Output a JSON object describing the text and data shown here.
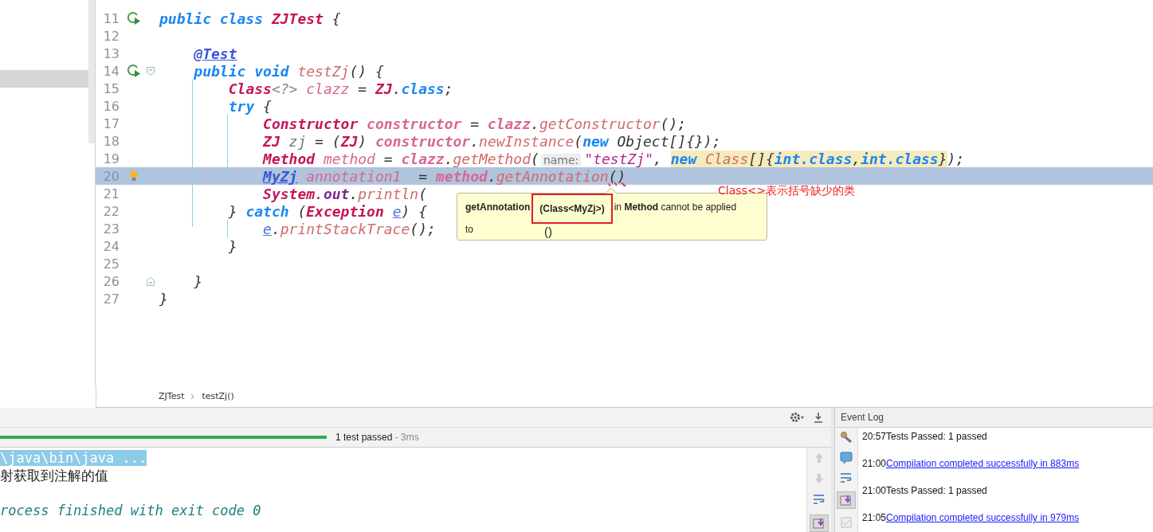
{
  "editor": {
    "lines": [
      {
        "number": "11",
        "selected": false,
        "gutter": {
          "kind": "run"
        },
        "tokens": [
          {
            "kind": "kw",
            "t": "public class "
          },
          {
            "kind": "type",
            "t": "ZJTest"
          },
          {
            "kind": "plain",
            "t": " {"
          }
        ]
      },
      {
        "number": "12",
        "selected": false
      },
      {
        "number": "13",
        "selected": false,
        "tokens": [
          {
            "kind": "annot",
            "t": "    @Test"
          }
        ]
      },
      {
        "number": "14",
        "selected": false,
        "gutter": {
          "kind": "run"
        },
        "fold": {
          "kind": "start"
        },
        "tokens": [
          {
            "kind": "kw",
            "t": "    public void "
          },
          {
            "kind": "method",
            "t": "testZj"
          },
          {
            "kind": "plain",
            "t": "() {"
          }
        ]
      },
      {
        "number": "15",
        "selected": false,
        "tokens": [
          {
            "kind": "type",
            "t": "        Class"
          },
          {
            "kind": "gen",
            "t": "<?>"
          },
          {
            "kind": "local",
            "t": " clazz"
          },
          {
            "kind": "plain",
            "t": " = "
          },
          {
            "kind": "type",
            "t": "ZJ"
          },
          {
            "kind": "plain",
            "t": "."
          },
          {
            "kind": "kw",
            "t": "class"
          },
          {
            "kind": "plain",
            "t": ";"
          }
        ]
      },
      {
        "number": "16",
        "selected": false,
        "tokens": [
          {
            "kind": "kw",
            "t": "        try"
          },
          {
            "kind": "plain",
            "t": " {"
          }
        ]
      },
      {
        "number": "17",
        "selected": false,
        "tokens": [
          {
            "kind": "type",
            "t": "            Constructor"
          },
          {
            "kind": "var",
            "t": " constructor"
          },
          {
            "kind": "plain",
            "t": " = "
          },
          {
            "kind": "var",
            "t": "clazz"
          },
          {
            "kind": "plain",
            "t": "."
          },
          {
            "kind": "method",
            "t": "getConstructor"
          },
          {
            "kind": "plain",
            "t": "();"
          }
        ]
      },
      {
        "number": "18",
        "selected": false,
        "tokens": [
          {
            "kind": "type",
            "t": "            ZJ"
          },
          {
            "kind": "unused",
            "t": " zj"
          },
          {
            "kind": "plain",
            "t": " = ("
          },
          {
            "kind": "type",
            "t": "ZJ"
          },
          {
            "kind": "plain",
            "t": ") "
          },
          {
            "kind": "var",
            "t": "constructor"
          },
          {
            "kind": "plain",
            "t": "."
          },
          {
            "kind": "method",
            "t": "newInstance"
          },
          {
            "kind": "plain",
            "t": "("
          },
          {
            "kind": "kw",
            "t": "new"
          },
          {
            "kind": "plain",
            "t": " Object[]{});"
          }
        ]
      },
      {
        "number": "19",
        "selected": false,
        "tokens": [
          {
            "kind": "type",
            "t": "            Method"
          },
          {
            "kind": "local",
            "t": " method"
          },
          {
            "kind": "plain",
            "t": " = "
          },
          {
            "kind": "var",
            "t": "clazz"
          },
          {
            "kind": "plain",
            "t": "."
          },
          {
            "kind": "method",
            "t": "getMethod"
          },
          {
            "kind": "plain",
            "t": "("
          },
          {
            "kind": "hint",
            "t": "name:"
          },
          {
            "kind": "string",
            "t": "\"testZj\""
          },
          {
            "kind": "plain",
            "t": ", "
          },
          {
            "kind": "group",
            "parts": [
              {
                "kind": "kw",
                "t": "new"
              },
              {
                "kind": "method",
                "t": " Class"
              },
              {
                "kind": "plain",
                "t": "[]{"
              },
              {
                "kind": "kw",
                "t": "int.class"
              },
              {
                "kind": "plain",
                "t": ","
              },
              {
                "kind": "kw",
                "t": "int.class"
              },
              {
                "kind": "plain",
                "t": "}"
              }
            ]
          },
          {
            "kind": "plain",
            "t": ");"
          }
        ]
      },
      {
        "number": "20",
        "selected": true,
        "gutter": {
          "kind": "bulb"
        },
        "tokens": [
          {
            "kind": "annot",
            "t": "            MyZj"
          },
          {
            "kind": "local",
            "t": " annotation1"
          },
          {
            "kind": "plain",
            "t": "  = "
          },
          {
            "kind": "var",
            "t": "method"
          },
          {
            "kind": "plain",
            "t": "."
          },
          {
            "kind": "method",
            "t": "getAnnotation"
          },
          {
            "kind": "error",
            "t": "()"
          }
        ]
      },
      {
        "number": "21",
        "selected": false,
        "tokens": [
          {
            "kind": "type",
            "t": "            System"
          },
          {
            "kind": "plain",
            "t": "."
          },
          {
            "kind": "field",
            "t": "out"
          },
          {
            "kind": "plain",
            "t": "."
          },
          {
            "kind": "method",
            "t": "println"
          },
          {
            "kind": "plain",
            "t": "("
          }
        ]
      },
      {
        "number": "22",
        "selected": false,
        "tokens": [
          {
            "kind": "plain",
            "t": "        } "
          },
          {
            "kind": "kw",
            "t": "catch"
          },
          {
            "kind": "plain",
            "t": " ("
          },
          {
            "kind": "type",
            "t": "Exception"
          },
          {
            "kind": "param",
            "t": " e"
          },
          {
            "kind": "plain",
            "t": ") {"
          }
        ]
      },
      {
        "number": "23",
        "selected": false,
        "tokens": [
          {
            "kind": "param",
            "t": "            e"
          },
          {
            "kind": "plain",
            "t": "."
          },
          {
            "kind": "method",
            "t": "printStackTrace"
          },
          {
            "kind": "plain",
            "t": "();"
          }
        ]
      },
      {
        "number": "24",
        "selected": false,
        "tokens": [
          {
            "kind": "plain",
            "t": "        }"
          }
        ]
      },
      {
        "number": "25",
        "selected": false
      },
      {
        "number": "26",
        "selected": false,
        "fold": {
          "kind": "end"
        },
        "tokens": [
          {
            "kind": "plain",
            "t": "    }"
          }
        ]
      },
      {
        "number": "27",
        "selected": false,
        "tokens": [
          {
            "kind": "plain",
            "t": "}"
          }
        ]
      }
    ],
    "tooltip": {
      "method": "getAnnotation",
      "signature": "(Class<MyZj>)",
      "message": "in **Method** cannot be applied",
      "line2_label": "to",
      "line2_value": "()"
    },
    "annotation_note": "Class<>表示括号缺少的类",
    "breadcrumbs": [
      "ZJTest",
      "testZj()"
    ]
  },
  "run_panel": {
    "progress": {
      "level": 1,
      "text": "1 test passed",
      "time": " - 3ms"
    },
    "console": [
      {
        "kind": "command",
        "text": "\\java\\bin\\java ..."
      },
      {
        "kind": "output",
        "text": "射获取到注解的值"
      },
      {
        "kind": "exit",
        "text": "rocess finished with exit code 0"
      }
    ]
  },
  "event_log": {
    "title": "Event Log",
    "entries": [
      {
        "time": "20:57",
        "kind": "plain",
        "message": "Tests Passed: 1 passed"
      },
      {
        "time": "21:00",
        "kind": "link",
        "message": "Compilation completed successfully in 883ms"
      },
      {
        "time": "21:00",
        "kind": "plain",
        "message": "Tests Passed: 1 passed"
      },
      {
        "time": "21:05",
        "kind": "link",
        "message": "Compilation completed successfully in 979ms"
      }
    ]
  }
}
